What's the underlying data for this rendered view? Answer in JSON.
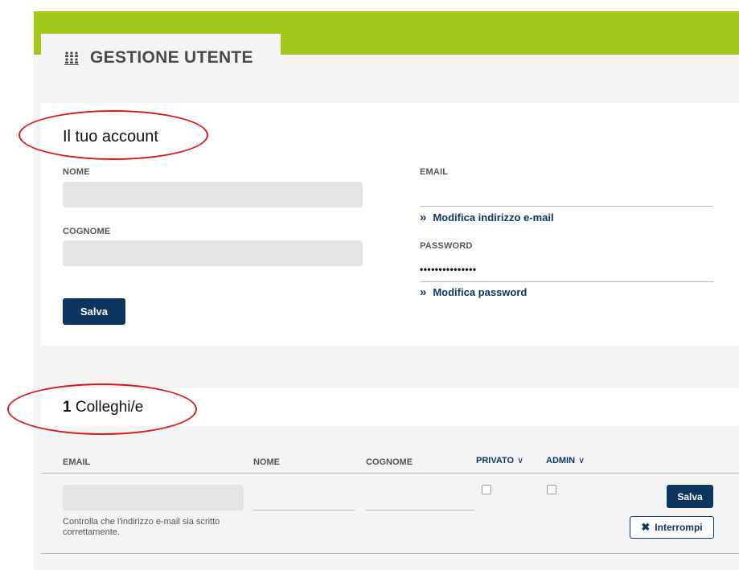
{
  "header": {
    "title": "GESTIONE UTENTE",
    "icon": "user-group-icon",
    "accent_color": "#a3c81c"
  },
  "account": {
    "title": "Il tuo account",
    "nome_label": "NOME",
    "nome_value": "",
    "cognome_label": "COGNOME",
    "cognome_value": "",
    "email_label": "EMAIL",
    "email_value": "",
    "change_email_link": "Modifica indirizzo e-mail",
    "password_label": "PASSWORD",
    "password_value": "•••••••••••••••",
    "change_password_link": "Modifica password",
    "save_label": "Salva"
  },
  "colleagues": {
    "count": "1",
    "title": "Colleghi/e",
    "columns": {
      "email": "EMAIL",
      "nome": "NOME",
      "cognome": "COGNOME",
      "privato": "PRIVATO",
      "admin": "ADMIN"
    },
    "row": {
      "email_value": "",
      "nome_value": "",
      "cognome_value": "",
      "privato_checked": false,
      "admin_checked": false,
      "hint": "Controlla che l'indirizzo e-mail sia scritto correttamente.",
      "save_label": "Salva",
      "cancel_label": "Interrompi"
    }
  },
  "colors": {
    "primary": "#0e3460",
    "annotation": "#d91818"
  }
}
